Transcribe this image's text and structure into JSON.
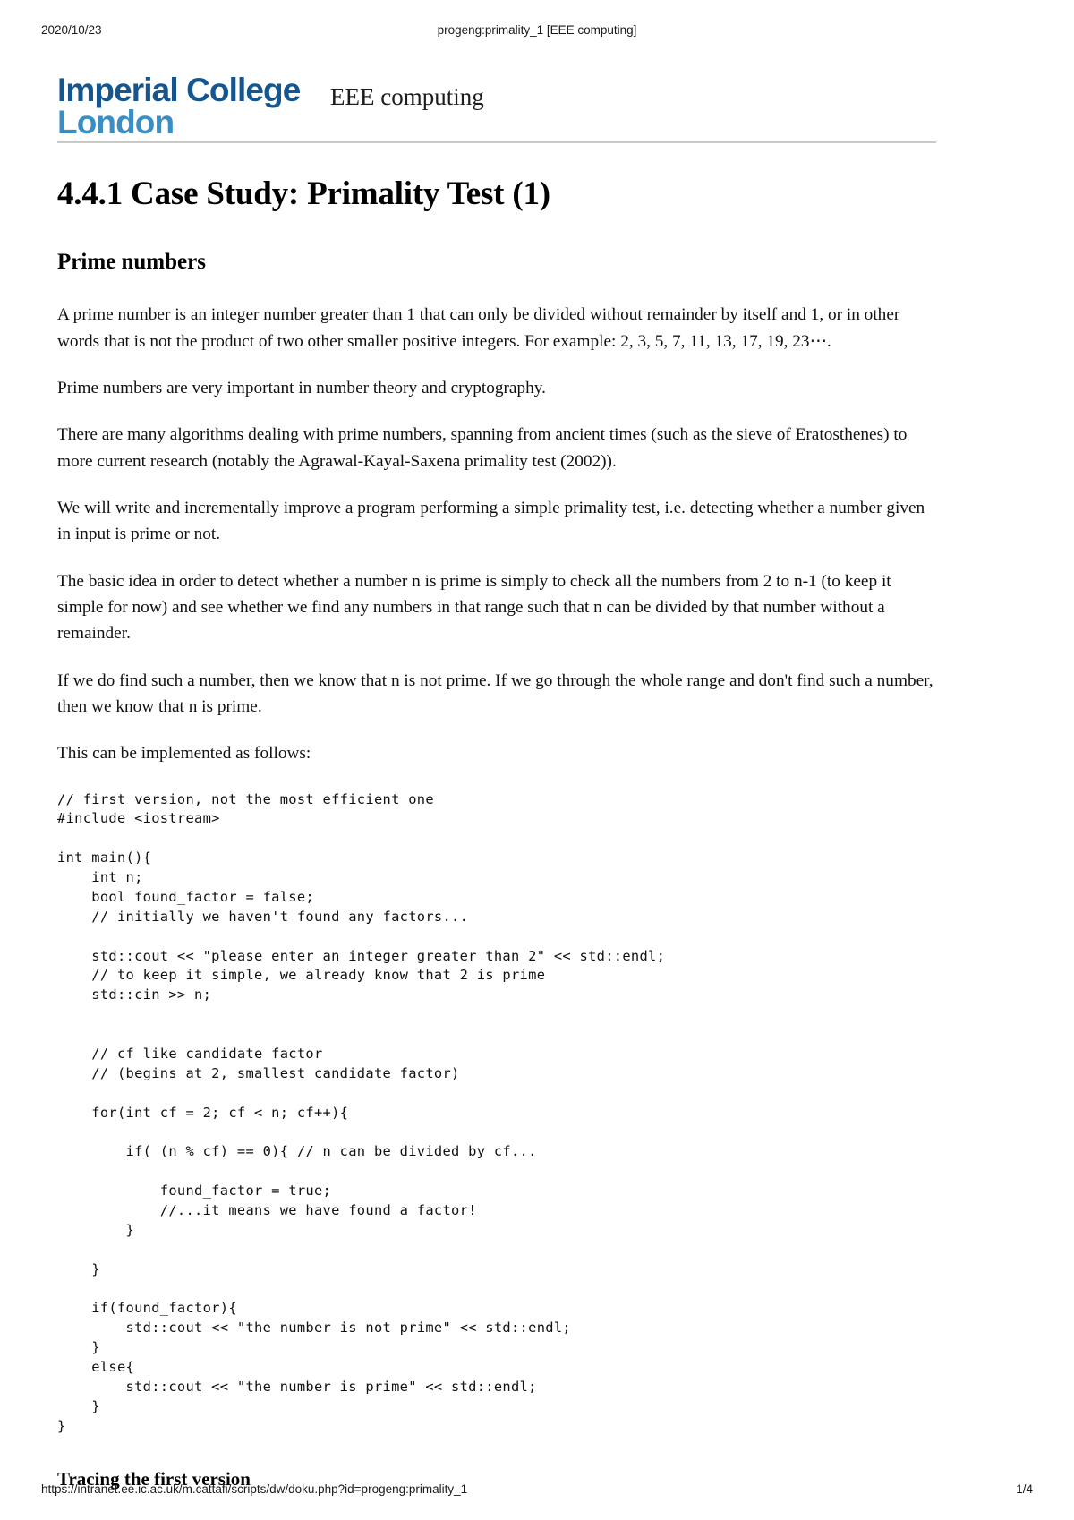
{
  "print_header": {
    "date": "2020/10/23",
    "doc_title": "progeng:primality_1 [EEE computing]"
  },
  "masthead": {
    "logo_line1": "Imperial College",
    "logo_line2": "London",
    "site_name": "EEE computing",
    "logo_color_primary": "#16568f",
    "logo_color_secondary": "#3a8ec4",
    "rule_color": "#c9c9c9"
  },
  "page_title": "4.4.1 Case Study: Primality Test (1)",
  "sections": {
    "prime_numbers_heading": "Prime numbers",
    "tracing_heading": "Tracing the first version"
  },
  "paragraphs": {
    "p1": "A prime number is an integer number greater than 1 that can only be divided without remainder by itself and 1, or in other words that is not the product of two other smaller positive integers. For example: 2,  3,  5,  7,  11,  13,  17,  19,  23⋯.",
    "p2": "Prime numbers are very important in number theory and cryptography.",
    "p3": "There are many algorithms dealing with prime numbers, spanning from ancient times (such as the sieve of Eratosthenes) to more current research (notably the Agrawal-Kayal-Saxena primality test (2002)).",
    "p4": "We will write and incrementally improve a program performing a simple primality test, i.e. detecting whether a number given in input is prime or not.",
    "p5": "The basic idea in order to detect whether a number n is prime is simply to check all the numbers from 2 to n-1 (to keep it simple for now) and see whether we find any numbers in that range such that n can be divided by that number without a remainder.",
    "p6": "If we do find such a number, then we know that n is not prime. If we go through the whole range and don't find such a number, then we know that n is prime.",
    "p7": "This can be implemented as follows:"
  },
  "code_block": {
    "language": "cpp",
    "text": "// first version, not the most efficient one\n#include <iostream>\n\nint main(){\n    int n;\n    bool found_factor = false;\n    // initially we haven't found any factors...\n\n    std::cout << \"please enter an integer greater than 2\" << std::endl;\n    // to keep it simple, we already know that 2 is prime\n    std::cin >> n;\n\n\n    // cf like candidate factor\n    // (begins at 2, smallest candidate factor)\n\n    for(int cf = 2; cf < n; cf++){\n\n        if( (n % cf) == 0){ // n can be divided by cf...\n\n            found_factor = true;\n            //...it means we have found a factor!\n        }\n\n    }\n\n    if(found_factor){\n        std::cout << \"the number is not prime\" << std::endl;\n    }\n    else{\n        std::cout << \"the number is prime\" << std::endl;\n    }\n}"
  },
  "print_footer": {
    "url": "https://intranet.ee.ic.ac.uk/m.cattafi/scripts/dw/doku.php?id=progeng:primality_1",
    "page_number": "1/4"
  }
}
